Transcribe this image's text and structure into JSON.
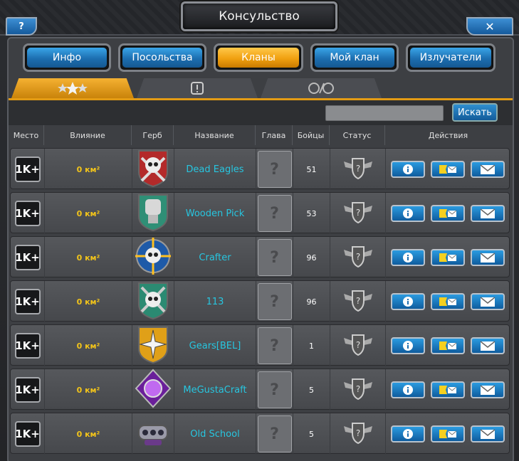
{
  "window": {
    "title": "Консульство",
    "help": "?",
    "close": "✕"
  },
  "nav_tabs": [
    "Инфо",
    "Посольства",
    "Кланы",
    "Мой клан",
    "Излучатели"
  ],
  "active_tab": "Кланы",
  "search": {
    "button": "Искать",
    "value": ""
  },
  "columns": [
    "Место",
    "Влияние",
    "Герб",
    "Название",
    "Глава",
    "Бойцы",
    "Статус",
    "Действия"
  ],
  "rows": [
    {
      "rank": "1K+",
      "influence": "0 км²",
      "name": "Dead Eagles",
      "leader": "?",
      "fighters": "51",
      "emblem": "skull-crossbones-red"
    },
    {
      "rank": "1K+",
      "influence": "0 км²",
      "name": "Wooden Pick",
      "leader": "?",
      "fighters": "53",
      "emblem": "fist-green"
    },
    {
      "rank": "1K+",
      "influence": "0 км²",
      "name": "Crafter",
      "leader": "?",
      "fighters": "96",
      "emblem": "skull-blue-crosshair"
    },
    {
      "rank": "1K+",
      "influence": "0 км²",
      "name": "113",
      "leader": "?",
      "fighters": "96",
      "emblem": "skull-green-cross"
    },
    {
      "rank": "1K+",
      "influence": "0 км²",
      "name": "Gears[BEL]",
      "leader": "?",
      "fighters": "1",
      "emblem": "star-gold-shield"
    },
    {
      "rank": "1K+",
      "influence": "0 км²",
      "name": "MeGustaCraft",
      "leader": "?",
      "fighters": "5",
      "emblem": "purple-gem"
    },
    {
      "rank": "1K+",
      "influence": "0 км²",
      "name": "Old School",
      "leader": "?",
      "fighters": "5",
      "emblem": "brass-knuckles"
    }
  ],
  "colors": {
    "accent_orange": "#f0a010",
    "button_blue": "#1c6eb0",
    "clan_name": "#27c6e0",
    "influence": "#f2c41a"
  }
}
